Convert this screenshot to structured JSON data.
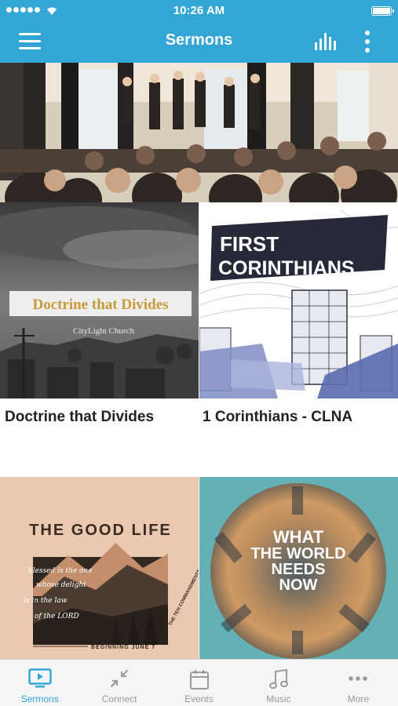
{
  "status_bar": {
    "time": "10:26 AM"
  },
  "header": {
    "title": "Sermons"
  },
  "series": [
    {
      "label": "Doctrine that Divides",
      "art_title": "Doctrine that Divides",
      "art_subtitle": "CityLight Church"
    },
    {
      "label": "1 Corinthians - CLNA",
      "art_title_line1": "FIRST",
      "art_title_line2": "CORINTHIANS"
    },
    {
      "art_title": "THE GOOD LIFE",
      "art_script_1": "blessed is the one",
      "art_script_2": "whose delight",
      "art_script_3": "is in the law",
      "art_script_4": "of the LORD",
      "art_ribbon": "THE TEN COMMANDMENTS",
      "art_footer": "BEGINNING JUNE 7"
    },
    {
      "art_title_line1": "WHAT",
      "art_title_line2": "THE WORLD",
      "art_title_line3": "NEEDS",
      "art_title_line4": "NOW"
    }
  ],
  "tabs": [
    {
      "label": "Sermons",
      "icon": "tv-icon",
      "active": true
    },
    {
      "label": "Connect",
      "icon": "connect-arrows-icon",
      "active": false
    },
    {
      "label": "Events",
      "icon": "calendar-icon",
      "active": false
    },
    {
      "label": "Music",
      "icon": "music-note-icon",
      "active": false
    },
    {
      "label": "More",
      "icon": "dots-icon",
      "active": false
    }
  ],
  "colors": {
    "accent": "#33a6d6",
    "tab_inactive": "#9b9b9b",
    "tab_bar_bg": "#f5f5f6"
  }
}
